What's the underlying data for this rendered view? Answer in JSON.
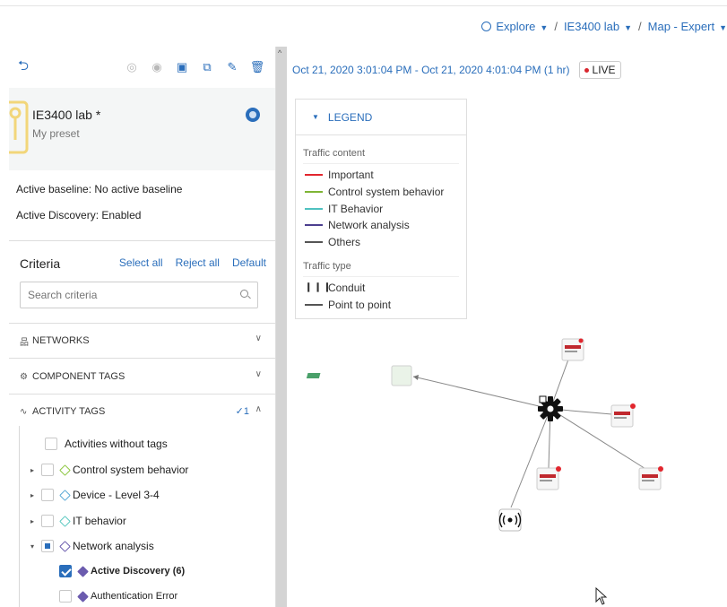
{
  "breadcrumb": {
    "explore": "Explore",
    "project": "IE3400 lab",
    "view": "Map - Expert",
    "separator": "/"
  },
  "toolbar": {
    "back_icon": "undo-icon",
    "icons": [
      "cluster-icon",
      "eye-icon",
      "save-icon",
      "save-as-icon",
      "edit-icon",
      "delete-icon"
    ]
  },
  "preset": {
    "name": "IE3400 lab *",
    "subtitle": "My preset",
    "pin_color": "#f2d67a"
  },
  "meta": {
    "baseline_label": "Active baseline:",
    "baseline_value": "No active baseline",
    "discovery_label": "Active Discovery:",
    "discovery_value": "Enabled"
  },
  "criteria": {
    "title": "Criteria",
    "select_all": "Select all",
    "reject_all": "Reject all",
    "default": "Default",
    "search_placeholder": "Search criteria",
    "sections": {
      "networks": "NETWORKS",
      "component_tags": "COMPONENT TAGS",
      "activity_tags": "ACTIVITY TAGS",
      "activity_count": "✓1"
    },
    "tree": [
      {
        "label": "Activities without tags",
        "state": "unchecked",
        "tag_color": ""
      },
      {
        "label": "Control system behavior",
        "state": "unchecked",
        "tag_color": "#8cc63f"
      },
      {
        "label": "Device - Level 3-4",
        "state": "unchecked",
        "tag_color": "#5aa9d6"
      },
      {
        "label": "IT behavior",
        "state": "unchecked",
        "tag_color": "#5ac8c0"
      },
      {
        "label": "Network analysis",
        "state": "partial",
        "tag_color": "#6b5bae"
      },
      {
        "label": "Active Discovery (6)",
        "state": "checked",
        "tag_color": "#6b5bae"
      },
      {
        "label": "Authentication Error",
        "state": "unchecked",
        "tag_color": "#6b5bae"
      }
    ]
  },
  "timebar": {
    "range": "Oct 21, 2020 3:01:04 PM - Oct 21, 2020 4:01:04 PM (1 hr)",
    "live": "LIVE"
  },
  "legend": {
    "title": "LEGEND",
    "content_caption": "Traffic content",
    "content_items": [
      {
        "label": "Important",
        "color": "#e2262e"
      },
      {
        "label": "Control system behavior",
        "color": "#7fb535"
      },
      {
        "label": "IT Behavior",
        "color": "#4fc1c0"
      },
      {
        "label": "Network analysis",
        "color": "#4c3f8f"
      },
      {
        "label": "Others",
        "color": "#555555"
      }
    ],
    "type_caption": "Traffic type",
    "type_items": [
      {
        "label": "Conduit",
        "style": "dashed"
      },
      {
        "label": "Point to point",
        "style": "solid"
      }
    ]
  },
  "map": {
    "hub_icon": "gear-icon",
    "nodes": [
      {
        "name": "controller-node",
        "badge": ""
      },
      {
        "name": "device-node",
        "badge": "!"
      },
      {
        "name": "device-node",
        "badge": "!"
      },
      {
        "name": "device-node",
        "badge": "!"
      },
      {
        "name": "device-node",
        "badge": "!"
      },
      {
        "name": "wireless-node",
        "badge": ""
      }
    ]
  }
}
